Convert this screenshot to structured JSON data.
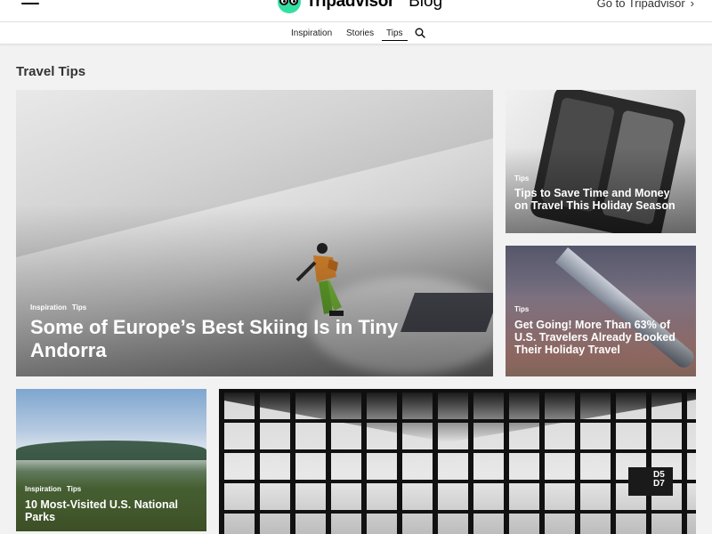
{
  "header": {
    "logo_text": "Tripadvisor",
    "logo_suffix": "Blog",
    "goto_label": "Go to Tripadvisor",
    "goto_icon": "chevron-right-icon"
  },
  "subnav": {
    "items": [
      "Inspiration",
      "Stories",
      "Tips"
    ],
    "active": "Tips",
    "search_icon": "search-icon"
  },
  "section_title": "Travel Tips",
  "cards": [
    {
      "tags": [
        "Inspiration",
        "Tips"
      ],
      "title": "Some of Europe’s Best Skiing Is in Tiny Andorra"
    },
    {
      "tags": [
        "Tips"
      ],
      "title": "Tips to Save Time and Money on Travel This Holiday Season"
    },
    {
      "tags": [
        "Tips"
      ],
      "title": "Get Going! More Than 63% of U.S. Travelers Already Booked Their Holiday Travel"
    },
    {
      "tags": [
        "Inspiration",
        "Tips"
      ],
      "title": "10 Most-Visited U.S. National Parks"
    },
    {
      "sign_text": "D5 D7"
    }
  ],
  "colors": {
    "brand_green": "#34e0a1",
    "text_dark": "#000000",
    "background": "#f2f2f2"
  }
}
